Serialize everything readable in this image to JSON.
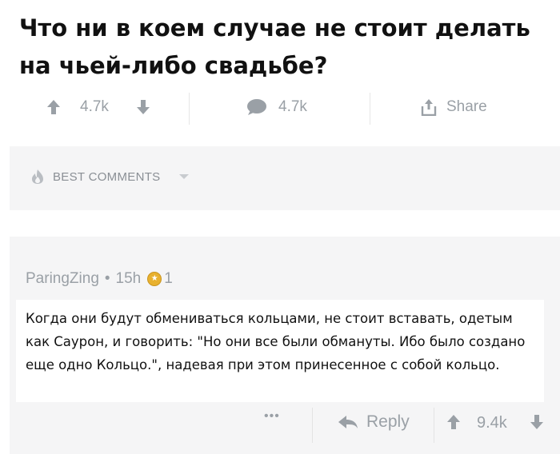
{
  "post": {
    "title": "Что ни в коем случае не стоит делать на чьей-либо свадьбе?"
  },
  "actions": {
    "upvote_icon": "arrow-up-icon",
    "vote_count": "4.7k",
    "downvote_icon": "arrow-down-icon",
    "comment_icon": "speech-bubble-icon",
    "comment_count": "4.7k",
    "share_icon": "share-icon",
    "share_label": "Share"
  },
  "sort": {
    "icon": "flame-icon",
    "label": "BEST COMMENTS"
  },
  "comment": {
    "author": "ParingZing",
    "separator": "•",
    "age": "15h",
    "award_icon": "award-coin-icon",
    "award_count": "1",
    "text": "Когда они будут обмениваться кольцами, не стоит вставать, одетым как Саурон, и говорить: \"Но они все были обмануты. Ибо было создано еще одно Кольцо.\", надевая при этом принесенное с собой кольцо.",
    "more_label": "•••",
    "reply_icon": "reply-arrow-icon",
    "reply_label": "Reply",
    "vote_count": "9.4k"
  },
  "colors": {
    "text": "#111111",
    "muted": "#9aa0a6",
    "panel": "#f5f5f6",
    "award": "#e8b12f"
  }
}
